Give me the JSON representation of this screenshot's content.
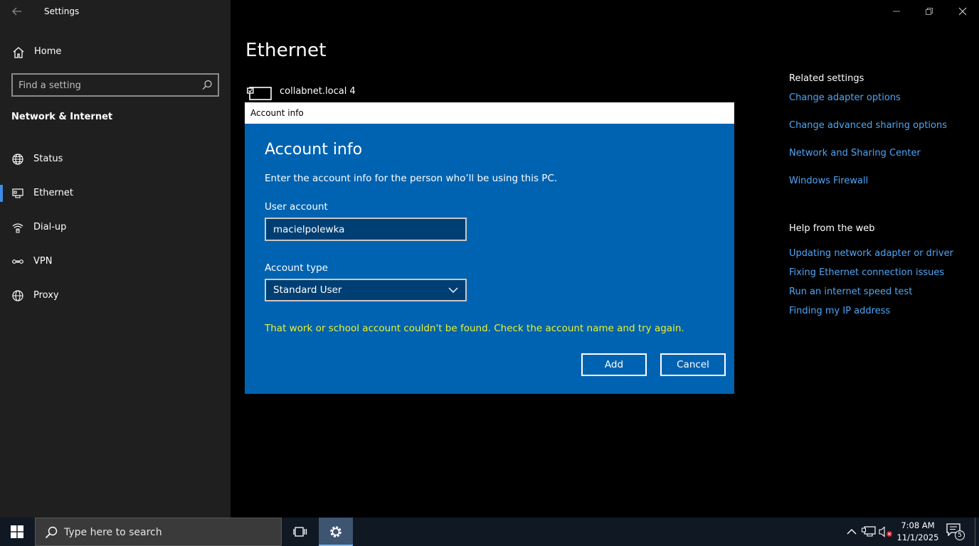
{
  "window": {
    "app_title": "Settings",
    "controls": [
      "minimize-icon",
      "restore-icon",
      "close-icon"
    ]
  },
  "sidebar": {
    "home_label": "Home",
    "search_placeholder": "Find a setting",
    "section_title": "Network & Internet",
    "items": [
      {
        "label": "Status",
        "icon": "status-globe-icon",
        "active": false
      },
      {
        "label": "Ethernet",
        "icon": "ethernet-icon",
        "active": true
      },
      {
        "label": "Dial-up",
        "icon": "dialup-icon",
        "active": false
      },
      {
        "label": "VPN",
        "icon": "vpn-icon",
        "active": false
      },
      {
        "label": "Proxy",
        "icon": "proxy-globe-icon",
        "active": false
      }
    ]
  },
  "main": {
    "title": "Ethernet",
    "adapter_name": "collabnet.local 4"
  },
  "related": {
    "heading": "Related settings",
    "links": [
      "Change adapter options",
      "Change advanced sharing options",
      "Network and Sharing Center",
      "Windows Firewall"
    ],
    "help_heading": "Help from the web",
    "help_links": [
      "Updating network adapter or driver",
      "Fixing Ethernet connection issues",
      "Run an internet speed test",
      "Finding my IP address"
    ]
  },
  "dialog": {
    "window_title": "Account info",
    "heading": "Account info",
    "description": "Enter the account info for the person who’ll be using this PC.",
    "user_account_label": "User account",
    "user_account_value": "macielpolewka",
    "account_type_label": "Account type",
    "account_type_value": "Standard User",
    "error": "That work or school account couldn't be found. Check the account name and try again.",
    "add_label": "Add",
    "cancel_label": "Cancel",
    "colors": {
      "background": "#0063b1",
      "error": "#eaf32b"
    }
  },
  "taskbar": {
    "search_placeholder": "Type here to search",
    "time": "7:08 AM",
    "date": "11/1/2025",
    "notification_count": "5"
  }
}
